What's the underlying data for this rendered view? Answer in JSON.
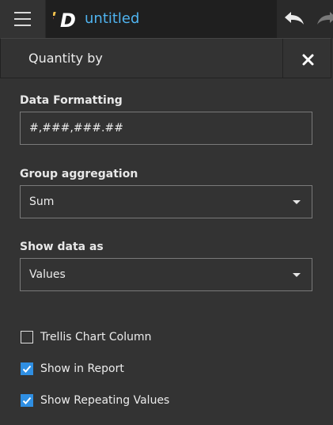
{
  "app": {
    "document_title": "untitled",
    "logo_letter": "D"
  },
  "icons": {
    "menu": "hamburger-icon",
    "undo": "undo-icon",
    "redo": "redo-icon",
    "close": "close-icon",
    "logo": "app-logo-icon"
  },
  "colors": {
    "accent": "#4fb3ef",
    "checkbox_checked": "#2f8fe3",
    "background": "#333333"
  },
  "panel": {
    "title": "Quantity by",
    "data_formatting": {
      "label": "Data Formatting",
      "value": "#,###,###.##"
    },
    "group_aggregation": {
      "label": "Group aggregation",
      "selected": "Sum"
    },
    "show_data_as": {
      "label": "Show data as",
      "selected": "Values"
    },
    "options": [
      {
        "label": "Trellis Chart Column",
        "checked": false
      },
      {
        "label": "Show in Report",
        "checked": true
      },
      {
        "label": "Show Repeating Values",
        "checked": true
      }
    ]
  }
}
